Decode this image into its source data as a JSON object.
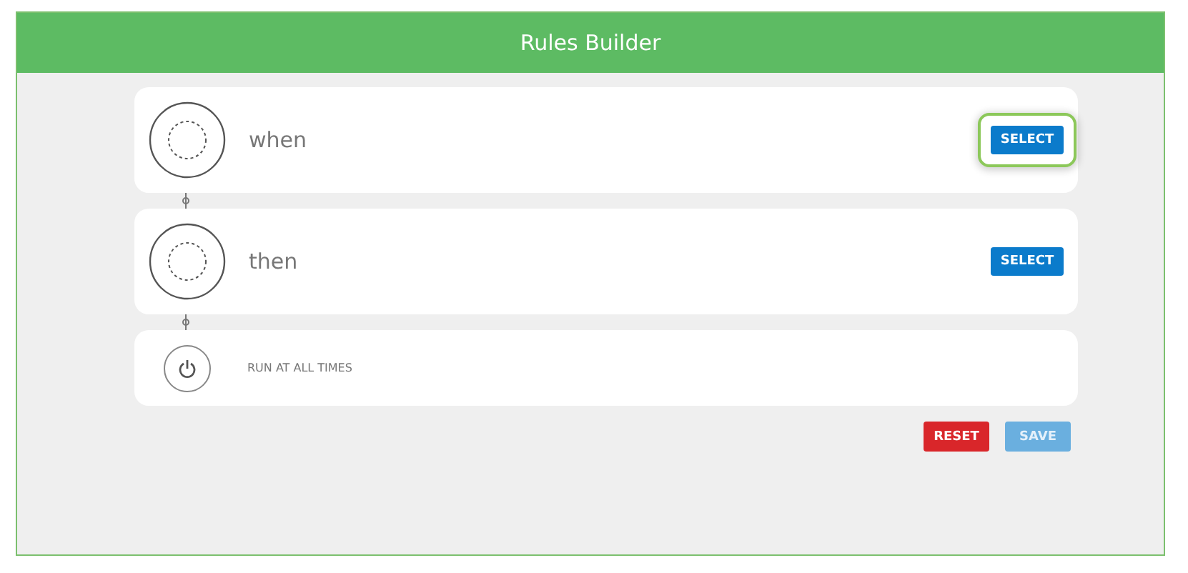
{
  "window": {
    "title": "Rules Builder"
  },
  "steps": [
    {
      "label": "when",
      "button": "SELECT",
      "focused": true
    },
    {
      "label": "then",
      "button": "SELECT",
      "focused": false
    }
  ],
  "schedule": {
    "text": "RUN AT ALL TIMES"
  },
  "buttons": [
    {
      "label": "RESET",
      "kind": "danger",
      "disabled": false
    },
    {
      "label": "SAVE",
      "kind": "primary",
      "disabled": true
    }
  ]
}
